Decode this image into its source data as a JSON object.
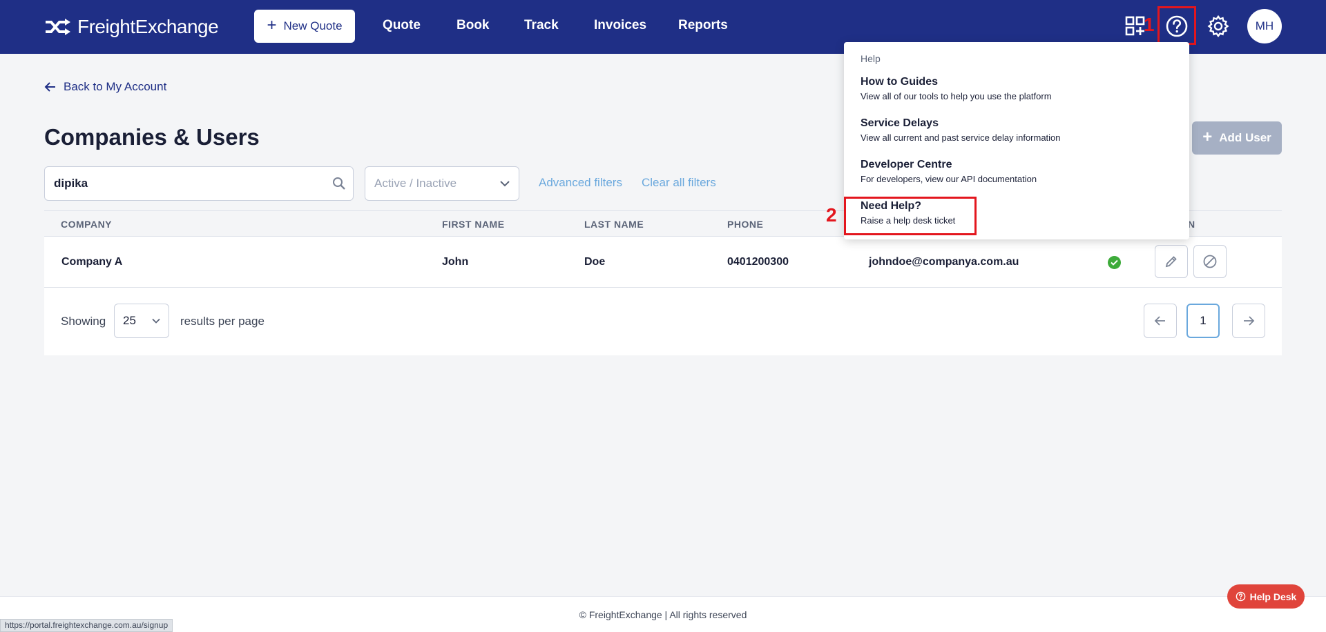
{
  "header": {
    "logo_text": "FreightExchange",
    "new_quote_label": "New Quote",
    "nav": [
      "Quote",
      "Book",
      "Track",
      "Invoices",
      "Reports"
    ],
    "avatar_initials": "MH",
    "icons": [
      "apps-grid-icon",
      "help-circle-icon",
      "gear-icon"
    ]
  },
  "annotations": {
    "one": "1",
    "two": "2"
  },
  "back_link": "Back to My Account",
  "page_title": "Companies & Users",
  "add_user_label": "Add User",
  "filters": {
    "search_value": "dipika",
    "status_placeholder": "Active / Inactive",
    "advanced_label": "Advanced filters",
    "clear_label": "Clear all filters"
  },
  "table": {
    "columns": [
      "COMPANY",
      "FIRST NAME",
      "LAST NAME",
      "PHONE",
      "N"
    ],
    "rows": [
      {
        "company": "Company A",
        "first_name": "John",
        "last_name": "Doe",
        "phone": "0401200300",
        "email": "johndoe@companya.com.au",
        "status": "active"
      }
    ]
  },
  "pagination": {
    "showing_label": "Showing",
    "per_page": "25",
    "per_page_label": "results per page",
    "current_page": "1"
  },
  "help_menu": {
    "caption": "Help",
    "items": [
      {
        "title": "How to Guides",
        "desc": "View all of our tools to help you use the platform"
      },
      {
        "title": "Service Delays",
        "desc": "View all current and past service delay information"
      },
      {
        "title": "Developer Centre",
        "desc": "For developers, view our API documentation"
      },
      {
        "title": "Need Help?",
        "desc": "Raise a help desk ticket"
      }
    ]
  },
  "footer_text": "© FreightExchange | All rights reserved",
  "help_desk_label": "Help Desk",
  "status_bar_url": "https://portal.freightexchange.com.au/signup",
  "colors": {
    "header_bg": "#1f2f86",
    "link": "#6aa8dd",
    "annotation": "#e3161e",
    "success": "#3dab3a",
    "help_desk": "#e0443b"
  }
}
